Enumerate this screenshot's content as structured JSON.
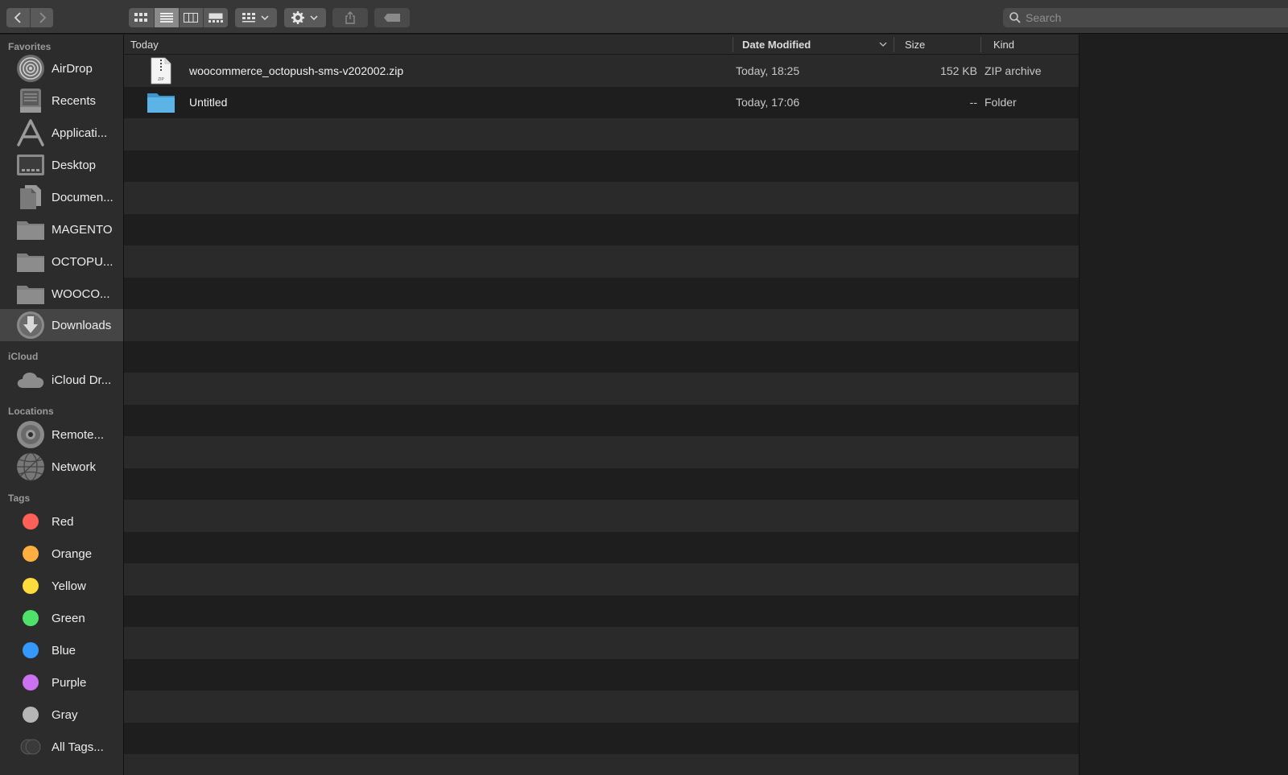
{
  "toolbar": {
    "back_label": "Back",
    "forward_label": "Forward",
    "search_placeholder": "Search"
  },
  "sidebar": {
    "favorites_title": "Favorites",
    "favorites": [
      {
        "label": "AirDrop",
        "icon": "airdrop-icon"
      },
      {
        "label": "Recents",
        "icon": "recents-icon"
      },
      {
        "label": "Applicati...",
        "icon": "applications-icon"
      },
      {
        "label": "Desktop",
        "icon": "desktop-icon"
      },
      {
        "label": "Documen...",
        "icon": "documents-icon"
      },
      {
        "label": "MAGENTO",
        "icon": "folder-icon"
      },
      {
        "label": "OCTOPU...",
        "icon": "folder-icon"
      },
      {
        "label": "WOOCO...",
        "icon": "folder-icon"
      },
      {
        "label": "Downloads",
        "icon": "downloads-icon",
        "selected": true
      }
    ],
    "icloud_title": "iCloud",
    "icloud": [
      {
        "label": "iCloud Dr...",
        "icon": "cloud-icon"
      }
    ],
    "locations_title": "Locations",
    "locations": [
      {
        "label": "Remote...",
        "icon": "disc-icon"
      },
      {
        "label": "Network",
        "icon": "network-icon"
      }
    ],
    "tags_title": "Tags",
    "tags": [
      {
        "label": "Red",
        "color": "#fe5f57"
      },
      {
        "label": "Orange",
        "color": "#ffae3f"
      },
      {
        "label": "Yellow",
        "color": "#fedb3d"
      },
      {
        "label": "Green",
        "color": "#4fe26a"
      },
      {
        "label": "Blue",
        "color": "#3599fb"
      },
      {
        "label": "Purple",
        "color": "#cc71f0"
      },
      {
        "label": "Gray",
        "color": "#b6b6b6"
      },
      {
        "label": "All Tags...",
        "color": "all"
      }
    ]
  },
  "columns": {
    "name": "Today",
    "date": "Date Modified",
    "size": "Size",
    "kind": "Kind"
  },
  "files": [
    {
      "name": "woocommerce_octopush-sms-v202002.zip",
      "date": "Today, 18:25",
      "size": "152 KB",
      "kind": "ZIP archive",
      "icon": "zip-file-icon"
    },
    {
      "name": "Untitled",
      "date": "Today, 17:06",
      "size": "--",
      "kind": "Folder",
      "icon": "folder-icon"
    }
  ],
  "colors": {
    "accent_folder": "#4aa6dd",
    "selected_row": "#454545"
  }
}
